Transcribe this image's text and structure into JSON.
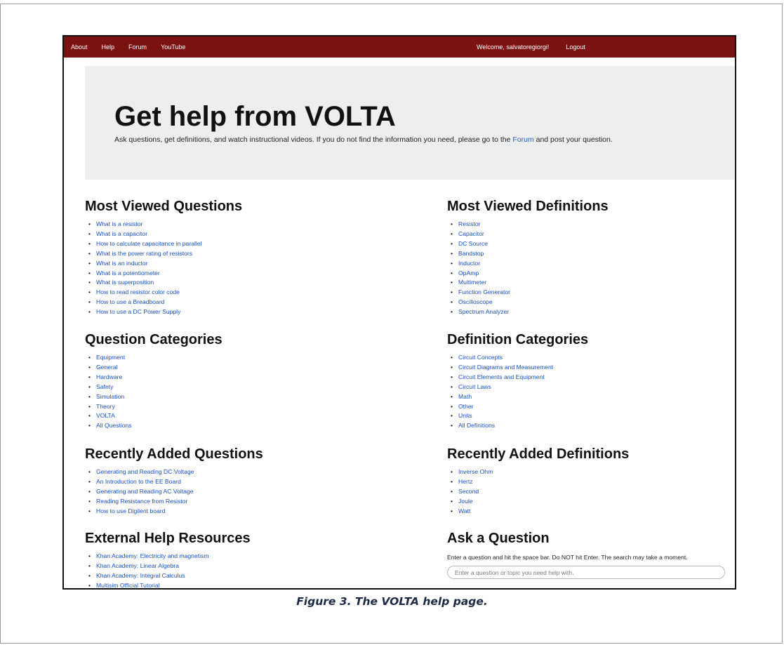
{
  "nav": {
    "left": [
      "About",
      "Help",
      "Forum",
      "YouTube"
    ],
    "welcome": "Welcome, salvatoregiorgi!",
    "logout": "Logout"
  },
  "jumbotron": {
    "title": "Get help from VOLTA",
    "lead_before": "Ask questions, get definitions, and watch instructional videos. If you do not find the information you need, please go to the ",
    "lead_link": "Forum",
    "lead_after": " and post your question."
  },
  "sections": {
    "most_viewed_questions": {
      "title": "Most Viewed Questions",
      "items": [
        "What is a resistor",
        "What is a capacitor",
        "How to calculate capacitance in parallel",
        "What is the power rating of resistors",
        "What is an inductor",
        "What is a potentiometer",
        "What is superposition",
        "How to read resistor color code",
        "How to use a Breadboard",
        "How to use a DC Power Supply"
      ]
    },
    "question_categories": {
      "title": "Question Categories",
      "items": [
        "Equipment",
        "General",
        "Hardware",
        "Safety",
        "Simulation",
        "Theory",
        "VOLTA",
        "All Questions"
      ]
    },
    "recently_added_questions": {
      "title": "Recently Added Questions",
      "items": [
        "Generating and Reading DC Voltage",
        "An Introduction to the EE Board",
        "Generating and Reading AC Voltage",
        "Reading Resistance from Resistor",
        "How to use Digilent board"
      ]
    },
    "external_help_resources": {
      "title": "External Help Resources",
      "items": [
        "Khan Academy: Electricity and magnetism",
        "Khan Academy: Linear Algebra",
        "Khan Academy: Integral Calculus",
        "Multisim Official Tutorial"
      ]
    },
    "most_viewed_definitions": {
      "title": "Most Viewed Definitions",
      "items": [
        "Resistor",
        "Capacitor",
        "DC Source",
        "Bandstop",
        "Inductor",
        "OpAmp",
        "Multimeter",
        "Function Generator",
        "Oscilloscope",
        "Spectrum Analyzer"
      ]
    },
    "definition_categories": {
      "title": "Definition Categories",
      "items": [
        "Circuit Concepts",
        "Circuit Diagrams and Measurement",
        "Circuit Elements and Equipment",
        "Circuit Laws",
        "Math",
        "Other",
        "Units",
        "All Definitions"
      ]
    },
    "recently_added_definitions": {
      "title": "Recently Added Definitions",
      "items": [
        "Inverse Ohm",
        "Hertz",
        "Second",
        "Joule",
        "Watt"
      ]
    }
  },
  "ask": {
    "title": "Ask a Question",
    "instructions": "Enter a question and hit the space bar. Do NOT hit Enter. The search may take a moment.",
    "placeholder": "Enter a question or topic you need help with."
  },
  "caption": "Figure 3. The VOLTA help page.",
  "colors": {
    "navbar": "#7a1212",
    "link": "#1a4fbf",
    "jumbotron_bg": "#eceeef"
  }
}
